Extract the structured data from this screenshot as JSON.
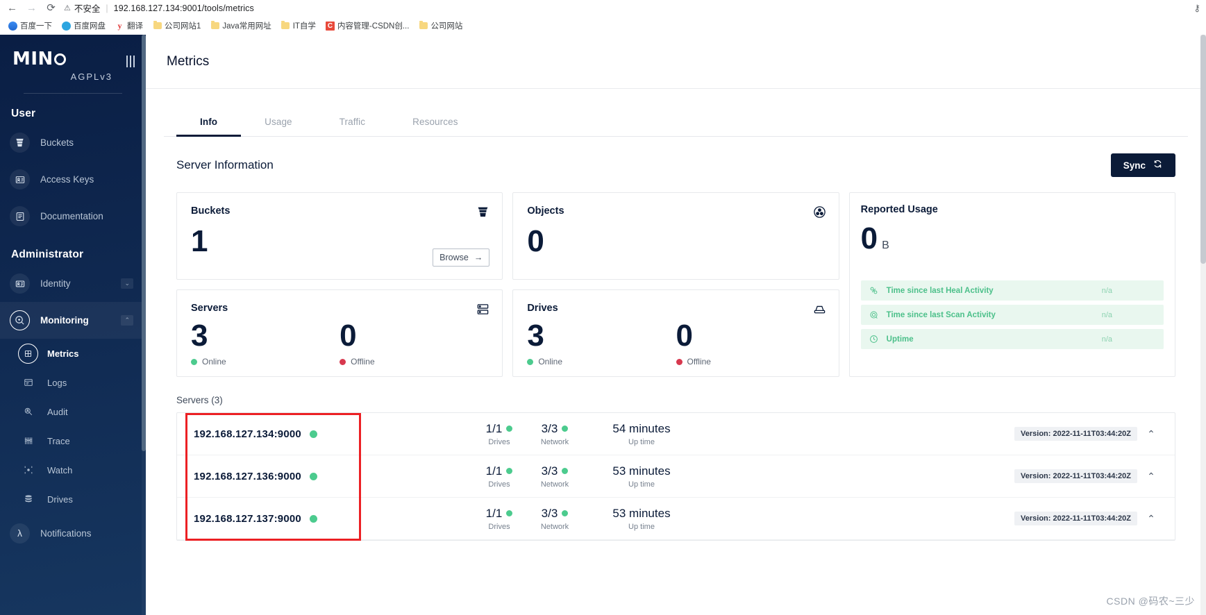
{
  "browser": {
    "back_icon": "←",
    "forward_icon": "→",
    "reload_icon": "⟳",
    "security_warning": "不安全",
    "security_icon": "⚠",
    "url": "192.168.127.134:9001/tools/metrics",
    "key_icon": "⚷",
    "bookmarks": [
      {
        "label": "百度一下",
        "icon": "baidu-icon"
      },
      {
        "label": "百度网盘",
        "icon": "baidu-pan-icon"
      },
      {
        "label": "翻译",
        "icon": "yandex-translate-icon"
      },
      {
        "label": "公司网站1",
        "icon": "folder-icon"
      },
      {
        "label": "Java常用网址",
        "icon": "folder-icon"
      },
      {
        "label": "IT自学",
        "icon": "folder-icon"
      },
      {
        "label": "内容管理-CSDN创...",
        "icon": "csdn-icon"
      },
      {
        "label": "公司网站",
        "icon": "folder-icon"
      }
    ]
  },
  "sidebar": {
    "logo_main": "MIN",
    "logo_suffix": "O",
    "logo_license": "AGPLv3",
    "sections": [
      {
        "title": "User",
        "items": [
          {
            "label": "Buckets",
            "icon": "bucket-icon",
            "state": "normal"
          },
          {
            "label": "Access Keys",
            "icon": "access-keys-icon",
            "state": "normal"
          },
          {
            "label": "Documentation",
            "icon": "documentation-icon",
            "state": "normal"
          }
        ]
      },
      {
        "title": "Administrator",
        "items": [
          {
            "label": "Identity",
            "icon": "identity-icon",
            "state": "collapsed",
            "caret": "⌄"
          },
          {
            "label": "Monitoring",
            "icon": "monitoring-icon",
            "state": "expanded",
            "caret": "⌃"
          }
        ]
      }
    ],
    "monitoring_children": [
      {
        "label": "Metrics",
        "icon": "metrics-icon",
        "state": "current"
      },
      {
        "label": "Logs",
        "icon": "logs-icon",
        "state": "normal"
      },
      {
        "label": "Audit",
        "icon": "audit-icon",
        "state": "normal"
      },
      {
        "label": "Trace",
        "icon": "trace-icon",
        "state": "normal"
      },
      {
        "label": "Watch",
        "icon": "watch-icon",
        "state": "normal"
      },
      {
        "label": "Drives",
        "icon": "drives-icon",
        "state": "normal"
      }
    ],
    "notifications": {
      "label": "Notifications",
      "icon": "lambda-icon"
    }
  },
  "header": {
    "title": "Metrics"
  },
  "tabs": [
    {
      "label": "Info",
      "selected": true
    },
    {
      "label": "Usage",
      "selected": false
    },
    {
      "label": "Traffic",
      "selected": false
    },
    {
      "label": "Resources",
      "selected": false
    }
  ],
  "server_info": {
    "section_title": "Server Information",
    "sync_label": "Sync",
    "sync_icon": "sync-icon"
  },
  "cards": {
    "buckets": {
      "title": "Buckets",
      "value": "1",
      "icon": "bucket-icon",
      "browse_label": "Browse",
      "browse_arrow": "→"
    },
    "objects": {
      "title": "Objects",
      "value": "0",
      "icon": "objects-icon"
    },
    "servers": {
      "title": "Servers",
      "icon": "servers-icon",
      "online_value": "3",
      "online_label": "Online",
      "offline_value": "0",
      "offline_label": "Offline"
    },
    "drives": {
      "title": "Drives",
      "icon": "drive-icon",
      "online_value": "3",
      "online_label": "Online",
      "offline_value": "0",
      "offline_label": "Offline"
    },
    "reported_usage": {
      "title": "Reported Usage",
      "value": "0",
      "unit": "B",
      "activities": [
        {
          "label": "Time since last Heal Activity",
          "value": "n/a",
          "icon": "heal-icon"
        },
        {
          "label": "Time since last Scan Activity",
          "value": "n/a",
          "icon": "scan-icon"
        },
        {
          "label": "Uptime",
          "value": "n/a",
          "icon": "uptime-icon"
        }
      ]
    }
  },
  "servers_list": {
    "heading": "Servers (3)",
    "rows": [
      {
        "address": "192.168.127.134:9000",
        "status": "online",
        "drives_value": "1/1",
        "drives_label": "Drives",
        "drives_status": "online",
        "network_value": "3/3",
        "network_label": "Network",
        "network_status": "online",
        "uptime_value": "54 minutes",
        "uptime_label": "Up time",
        "version": "Version: 2022-11-11T03:44:20Z",
        "chevron": "⌃"
      },
      {
        "address": "192.168.127.136:9000",
        "status": "online",
        "drives_value": "1/1",
        "drives_label": "Drives",
        "drives_status": "online",
        "network_value": "3/3",
        "network_label": "Network",
        "network_status": "online",
        "uptime_value": "53 minutes",
        "uptime_label": "Up time",
        "version": "Version: 2022-11-11T03:44:20Z",
        "chevron": "⌃"
      },
      {
        "address": "192.168.127.137:9000",
        "status": "online",
        "drives_value": "1/1",
        "drives_label": "Drives",
        "drives_status": "online",
        "network_value": "3/3",
        "network_label": "Network",
        "network_status": "online",
        "uptime_value": "53 minutes",
        "uptime_label": "Up time",
        "version": "Version: 2022-11-11T03:44:20Z",
        "chevron": "⌃"
      }
    ]
  },
  "watermark": "CSDN @码农~三少",
  "colors": {
    "sidebar_dark": "#0a1e44",
    "accent_navy": "#0b1b38",
    "online_green": "#4ccb8e",
    "offline_red": "#d7384e",
    "activity_green": "#4cc08a",
    "annotation_red": "#ec2024"
  }
}
